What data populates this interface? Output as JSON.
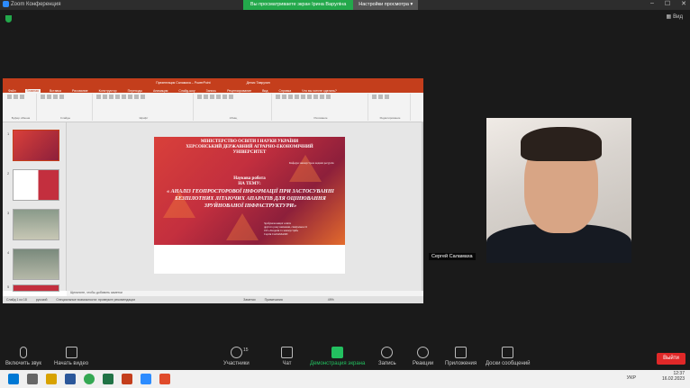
{
  "window": {
    "title": "Zoom Конференция",
    "banner_viewing": "Вы просматриваете экран Ірина Варуліна",
    "banner_view_options": "Настройки просмотра",
    "view_label": "Вид"
  },
  "ppt": {
    "title": "Презентация Саламаха – PowerPoint",
    "user": "Денис Таврулин",
    "tabs": [
      "Файл",
      "Главная",
      "Вставка",
      "Рисование",
      "Конструктор",
      "Переходы",
      "Анимация",
      "Слайд-шоу",
      "Запись",
      "Рецензирование",
      "Вид",
      "Справка",
      "Что вы хотите сделать?"
    ],
    "groups": [
      "Буфер обмена",
      "Слайды",
      "Шрифт",
      "Абзац",
      "Рисование",
      "Редактирование"
    ],
    "notes_placeholder": "Щелкните, чтобы добавить заметки",
    "status_left": "Слайд 1 из 18",
    "status_lang": "русский",
    "status_access": "Специальные возможности: проверьте рекомендации",
    "status_notes": "Заметки",
    "status_comments": "Примечания",
    "zoom": "49%"
  },
  "slide": {
    "line1": "МІНІСТЕРСТВО ОСВІТИ І НАУКИ УКРАЇНИ",
    "line2": "ХЕРСОНСЬКИЙ ДЕРЖАВНИЙ АГРАРНО-ЕКОНОМІЧНИЙ",
    "line3": "УНІВЕРСИТЕТ",
    "dept": "Кафедра землеустрою водних ресурсів",
    "work": "Наукова робота",
    "topic": "НА ТЕМУ:",
    "title": "« АНАЛІЗ ГЕОПРОСТОРОВОЇ ІНФОРМАЦІЇ ПРИ ЗАСТОСУВАННІ БЕЗПІЛОТНИХ ЛІТАЮЧИХ АПАРАТІВ ДЛЯ ОЦІНЮВАННЯ ЗРУЙНОВАНОЇ ІНФРАСТРУКТУРИ»",
    "author1": "Здобувача вищої освіти",
    "author2": "другого року навчання, спеціальності",
    "author3": "193 «Геодезія та землеустрій»",
    "author4": "Сергія САЛАМАХИ"
  },
  "participant": {
    "name": "Сергей Саламаха"
  },
  "controls": {
    "mute": "Включить звук",
    "video": "Начать видео",
    "participants": "Участники",
    "participants_count": "15",
    "chat": "Чат",
    "share": "Демонстрация экрана",
    "record": "Запись",
    "reactions": "Реакции",
    "apps": "Приложения",
    "whiteboard": "Доски сообщений",
    "leave": "Выйти"
  },
  "tray": {
    "lang": "УКР",
    "time": "12:37",
    "date": "16.02.2023"
  },
  "colors": {
    "zoom_green": "#23a84b",
    "ppt_red": "#c43e1c",
    "leave_red": "#e02828"
  }
}
